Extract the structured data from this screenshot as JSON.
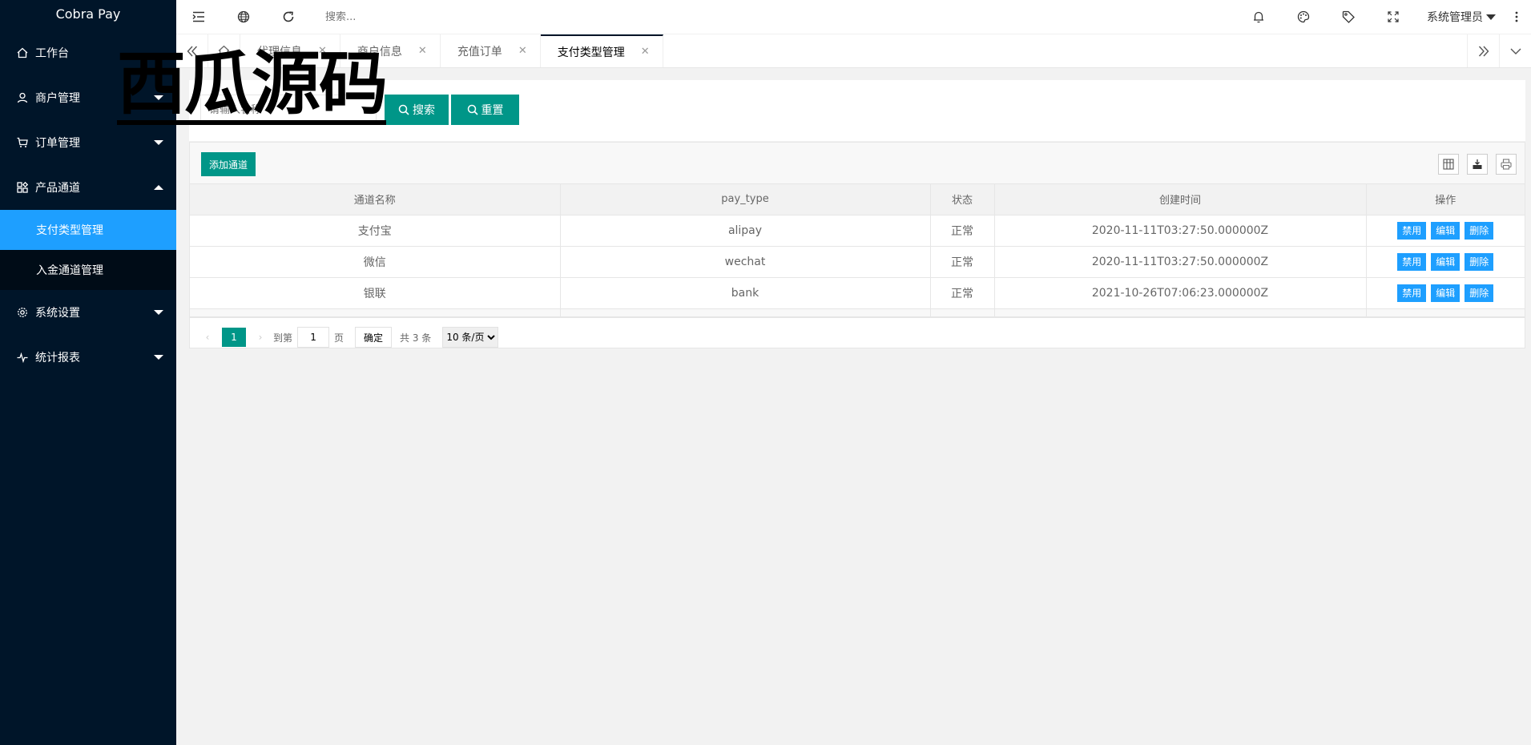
{
  "app": {
    "title": "Cobra Pay"
  },
  "sidebar": {
    "items": [
      {
        "label": "工作台",
        "icon": "home-icon"
      },
      {
        "label": "商户管理",
        "icon": "user-icon"
      },
      {
        "label": "订单管理",
        "icon": "cart-icon"
      },
      {
        "label": "产品通道",
        "icon": "apps-icon",
        "expanded": true,
        "children": [
          {
            "label": "支付类型管理",
            "active": true
          },
          {
            "label": "入金通道管理"
          }
        ]
      },
      {
        "label": "系统设置",
        "icon": "gear-icon"
      },
      {
        "label": "统计报表",
        "icon": "pulse-icon"
      }
    ]
  },
  "header": {
    "search_placeholder": "搜索...",
    "user": "系统管理员"
  },
  "tabs": [
    {
      "label": "代理信息"
    },
    {
      "label": "商户信息"
    },
    {
      "label": "充值订单"
    },
    {
      "label": "支付类型管理",
      "active": true
    }
  ],
  "search": {
    "input_placeholder": "请输入名称",
    "search_label": "搜索",
    "reset_label": "重置"
  },
  "toolbar": {
    "add_label": "添加通道"
  },
  "table": {
    "columns": [
      "通道名称",
      "pay_type",
      "状态",
      "创建时间",
      "操作"
    ],
    "rows": [
      {
        "name": "支付宝",
        "pay_type": "alipay",
        "status": "正常",
        "created": "2020-11-11T03:27:50.000000Z"
      },
      {
        "name": "微信",
        "pay_type": "wechat",
        "status": "正常",
        "created": "2020-11-11T03:27:50.000000Z"
      },
      {
        "name": "银联",
        "pay_type": "bank",
        "status": "正常",
        "created": "2021-10-26T07:06:23.000000Z"
      }
    ],
    "actions": {
      "disable": "禁用",
      "edit": "编辑",
      "delete": "删除"
    }
  },
  "pager": {
    "current": "1",
    "goto_label": "到第",
    "goto_value": "1",
    "page_unit": "页",
    "confirm_label": "确定",
    "total": "共 3 条",
    "page_size": "10 条/页"
  },
  "watermark": {
    "text": "西瓜源码"
  },
  "colors": {
    "sidebar_bg": "#001529",
    "active_blue": "#1e9fff",
    "teal": "#009688"
  }
}
